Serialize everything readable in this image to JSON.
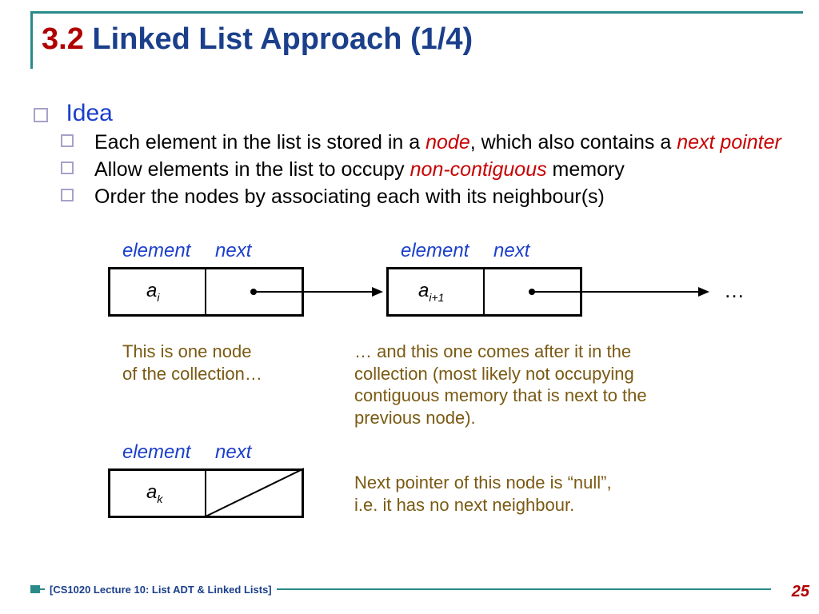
{
  "title": {
    "section": "3.2",
    "rest": " Linked List Approach (1/4)"
  },
  "idea_label": "Idea",
  "bullets": {
    "b1a": "Each element in the list is stored in a ",
    "b1_node": "node",
    "b1b": ", which also contains a ",
    "b1_next": "next pointer",
    "b2a": "Allow elements in the list to occupy ",
    "b2_nc": "non-contiguous",
    "b2b": " memory",
    "b3": "Order the nodes by associating each with its neighbour(s)"
  },
  "diagram": {
    "element": "element",
    "next": "next",
    "a_i": "a",
    "sub_i": "i",
    "sub_i1": "i+1",
    "sub_k": "k",
    "dots": "…"
  },
  "captions": {
    "c1": "This is one node\nof the collection…",
    "c2": "… and this one comes after it in the collection (most likely not occupying contiguous memory that is next to the previous node).",
    "c3": "Next pointer of this node is “null”,\ni.e. it has no next neighbour."
  },
  "footer": {
    "label": "[CS1020 Lecture 10: List ADT & Linked Lists]",
    "page": "25"
  }
}
